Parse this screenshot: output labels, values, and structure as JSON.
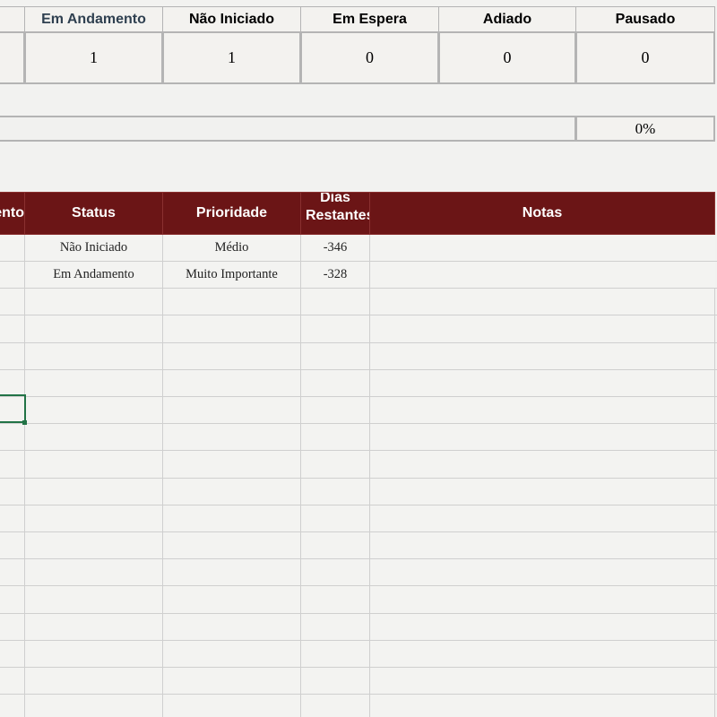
{
  "summary": {
    "headers": [
      "Em Andamento",
      "Não Iniciado",
      "Em Espera",
      "Adiado",
      "Pausado"
    ],
    "values": [
      "1",
      "1",
      "0",
      "0",
      "0"
    ]
  },
  "progress": {
    "percent_label": "0%",
    "percent_value": 0
  },
  "table": {
    "columns": [
      "ento",
      "Status",
      "Prioridade",
      "Dias Restantes",
      "Notas"
    ],
    "rows": [
      {
        "status": "Não Iniciado",
        "priority": "Médio",
        "days": "-346",
        "notes": ""
      },
      {
        "status": "Em Andamento",
        "priority": "Muito Importante",
        "days": "-328",
        "notes": ""
      }
    ]
  },
  "colors": {
    "header_bg": "#6b1516",
    "selected_cell_border": "#217346",
    "accent_text": "#2f4050"
  }
}
